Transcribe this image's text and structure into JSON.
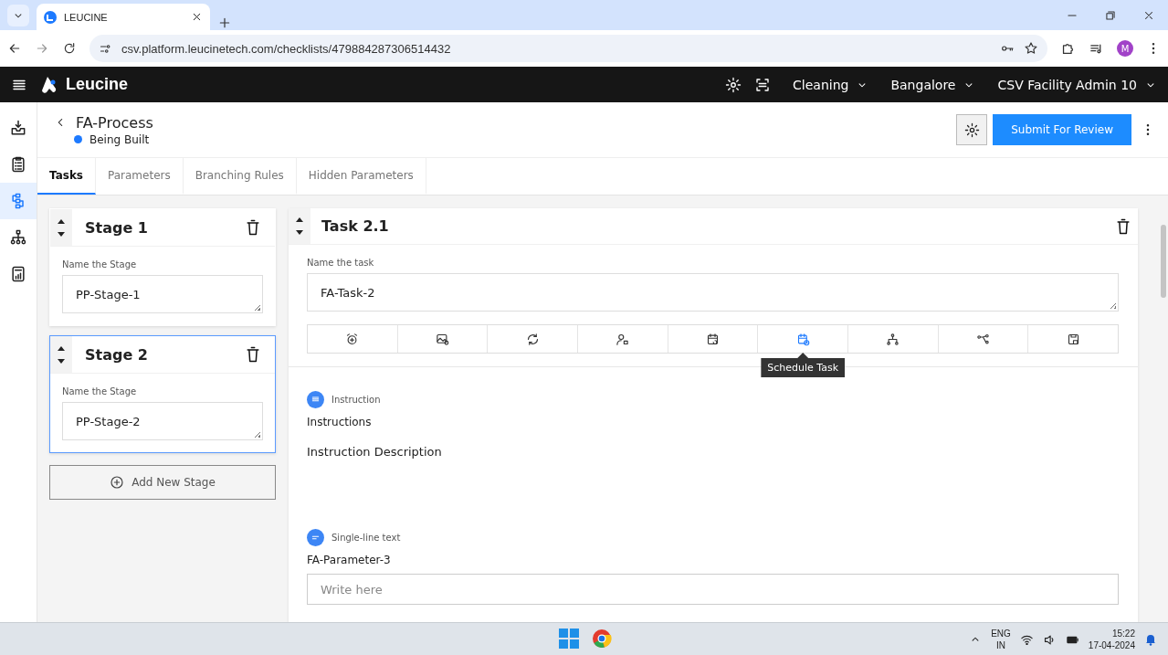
{
  "browser": {
    "tab_title": "LEUCINE",
    "url": "csv.platform.leucinetech.com/checklists/479884287306514432",
    "profile_initial": "M"
  },
  "header": {
    "brand": "Leucine",
    "menus": [
      "Cleaning",
      "Bangalore",
      "CSV Facility Admin 10"
    ]
  },
  "sidebar": {
    "items": [
      {
        "selected": false
      },
      {
        "selected": false
      },
      {
        "selected": true
      },
      {
        "selected": false
      },
      {
        "selected": false
      }
    ]
  },
  "page": {
    "title": "FA-Process",
    "status": "Being Built",
    "submit": "Submit For Review"
  },
  "tabs": [
    {
      "label": "Tasks",
      "selected": true
    },
    {
      "label": "Parameters",
      "selected": false
    },
    {
      "label": "Branching Rules",
      "selected": false
    },
    {
      "label": "Hidden Parameters",
      "selected": false
    }
  ],
  "stages": [
    {
      "title": "Stage 1",
      "field_label": "Name the Stage",
      "value": "PP-Stage-1",
      "selected": false
    },
    {
      "title": "Stage 2",
      "field_label": "Name the Stage",
      "value": "PP-Stage-2",
      "selected": true
    }
  ],
  "add_stage": "Add New Stage",
  "task": {
    "title": "Task 2.1",
    "field_label": "Name the task",
    "value": "FA-Task-2",
    "toolbar": [
      {
        "selected": false
      },
      {
        "selected": false
      },
      {
        "selected": false
      },
      {
        "selected": false
      },
      {
        "selected": false
      },
      {
        "selected": true
      },
      {
        "selected": false
      },
      {
        "selected": false
      },
      {
        "selected": false
      }
    ],
    "tooltip": "Schedule Task"
  },
  "parameters": [
    {
      "kind": "instruction",
      "type_label": "Instruction",
      "name": "Instructions",
      "description": "Instruction Description"
    },
    {
      "kind": "single-line",
      "type_label": "Single-line text",
      "name": "FA-Parameter-3",
      "placeholder": "Write here"
    }
  ],
  "taskbar": {
    "language": "ENG",
    "region": "IN",
    "time": "15:22",
    "date": "17-04-2024"
  }
}
